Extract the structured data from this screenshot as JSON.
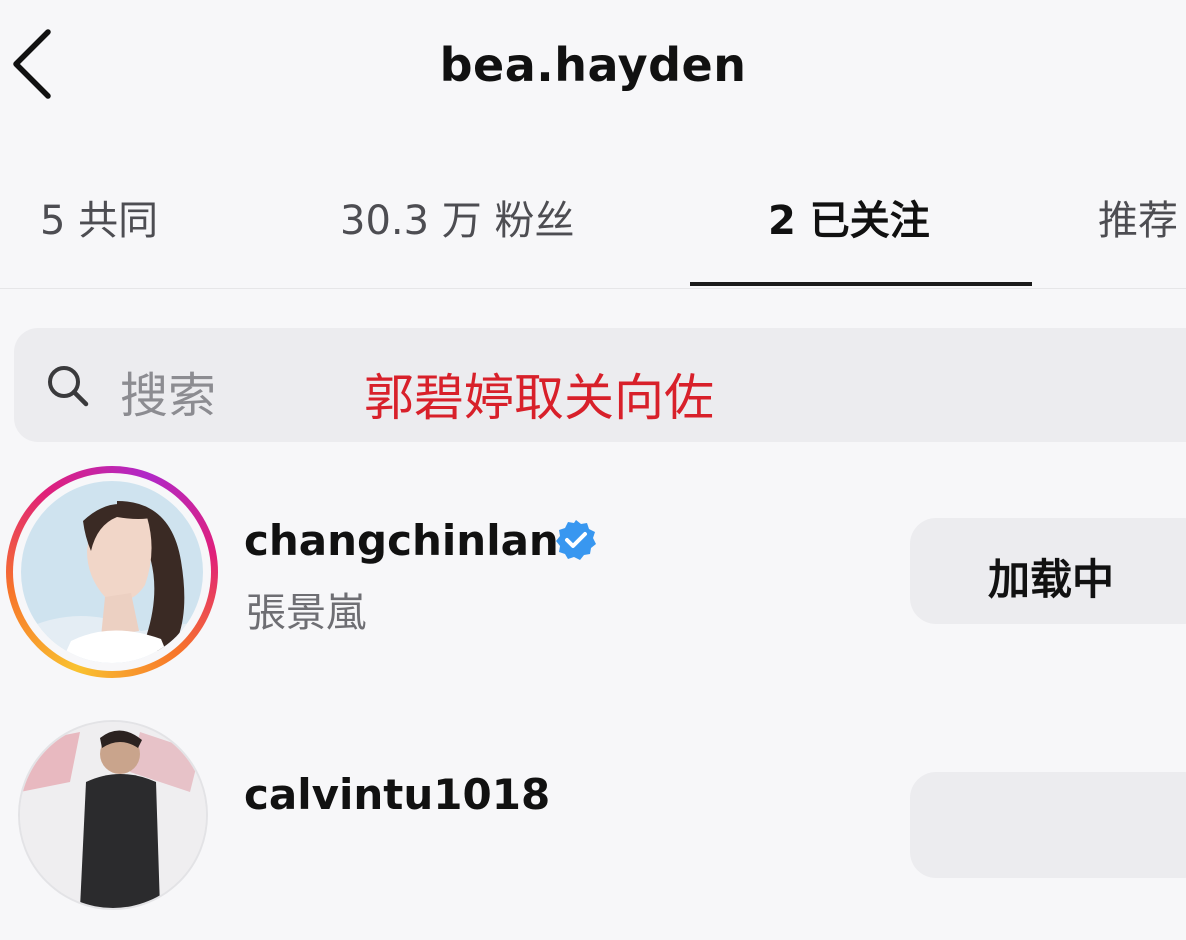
{
  "header": {
    "title": "bea.hayden",
    "back_icon": "chevron-left-icon"
  },
  "tabs": [
    {
      "label": "5 共同",
      "active": false
    },
    {
      "label": "30.3 万 粉丝",
      "active": false
    },
    {
      "label": "2 已关注",
      "active": true
    },
    {
      "label": "推荐",
      "active": false
    }
  ],
  "search": {
    "placeholder": "搜索",
    "icon": "search-icon"
  },
  "overlay_caption": "郭碧婷取关向佐",
  "users": [
    {
      "username": "changchinlan",
      "full_name": "張景嵐",
      "verified": true,
      "has_story": true,
      "button_label": "加载中"
    },
    {
      "username": "calvintu1018",
      "full_name": "",
      "verified": false,
      "has_story": false,
      "button_label": ""
    }
  ],
  "colors": {
    "background": "#f7f7f9",
    "search_bg": "#ececef",
    "verified_blue": "#3897f0",
    "overlay_red": "#d8202a"
  }
}
